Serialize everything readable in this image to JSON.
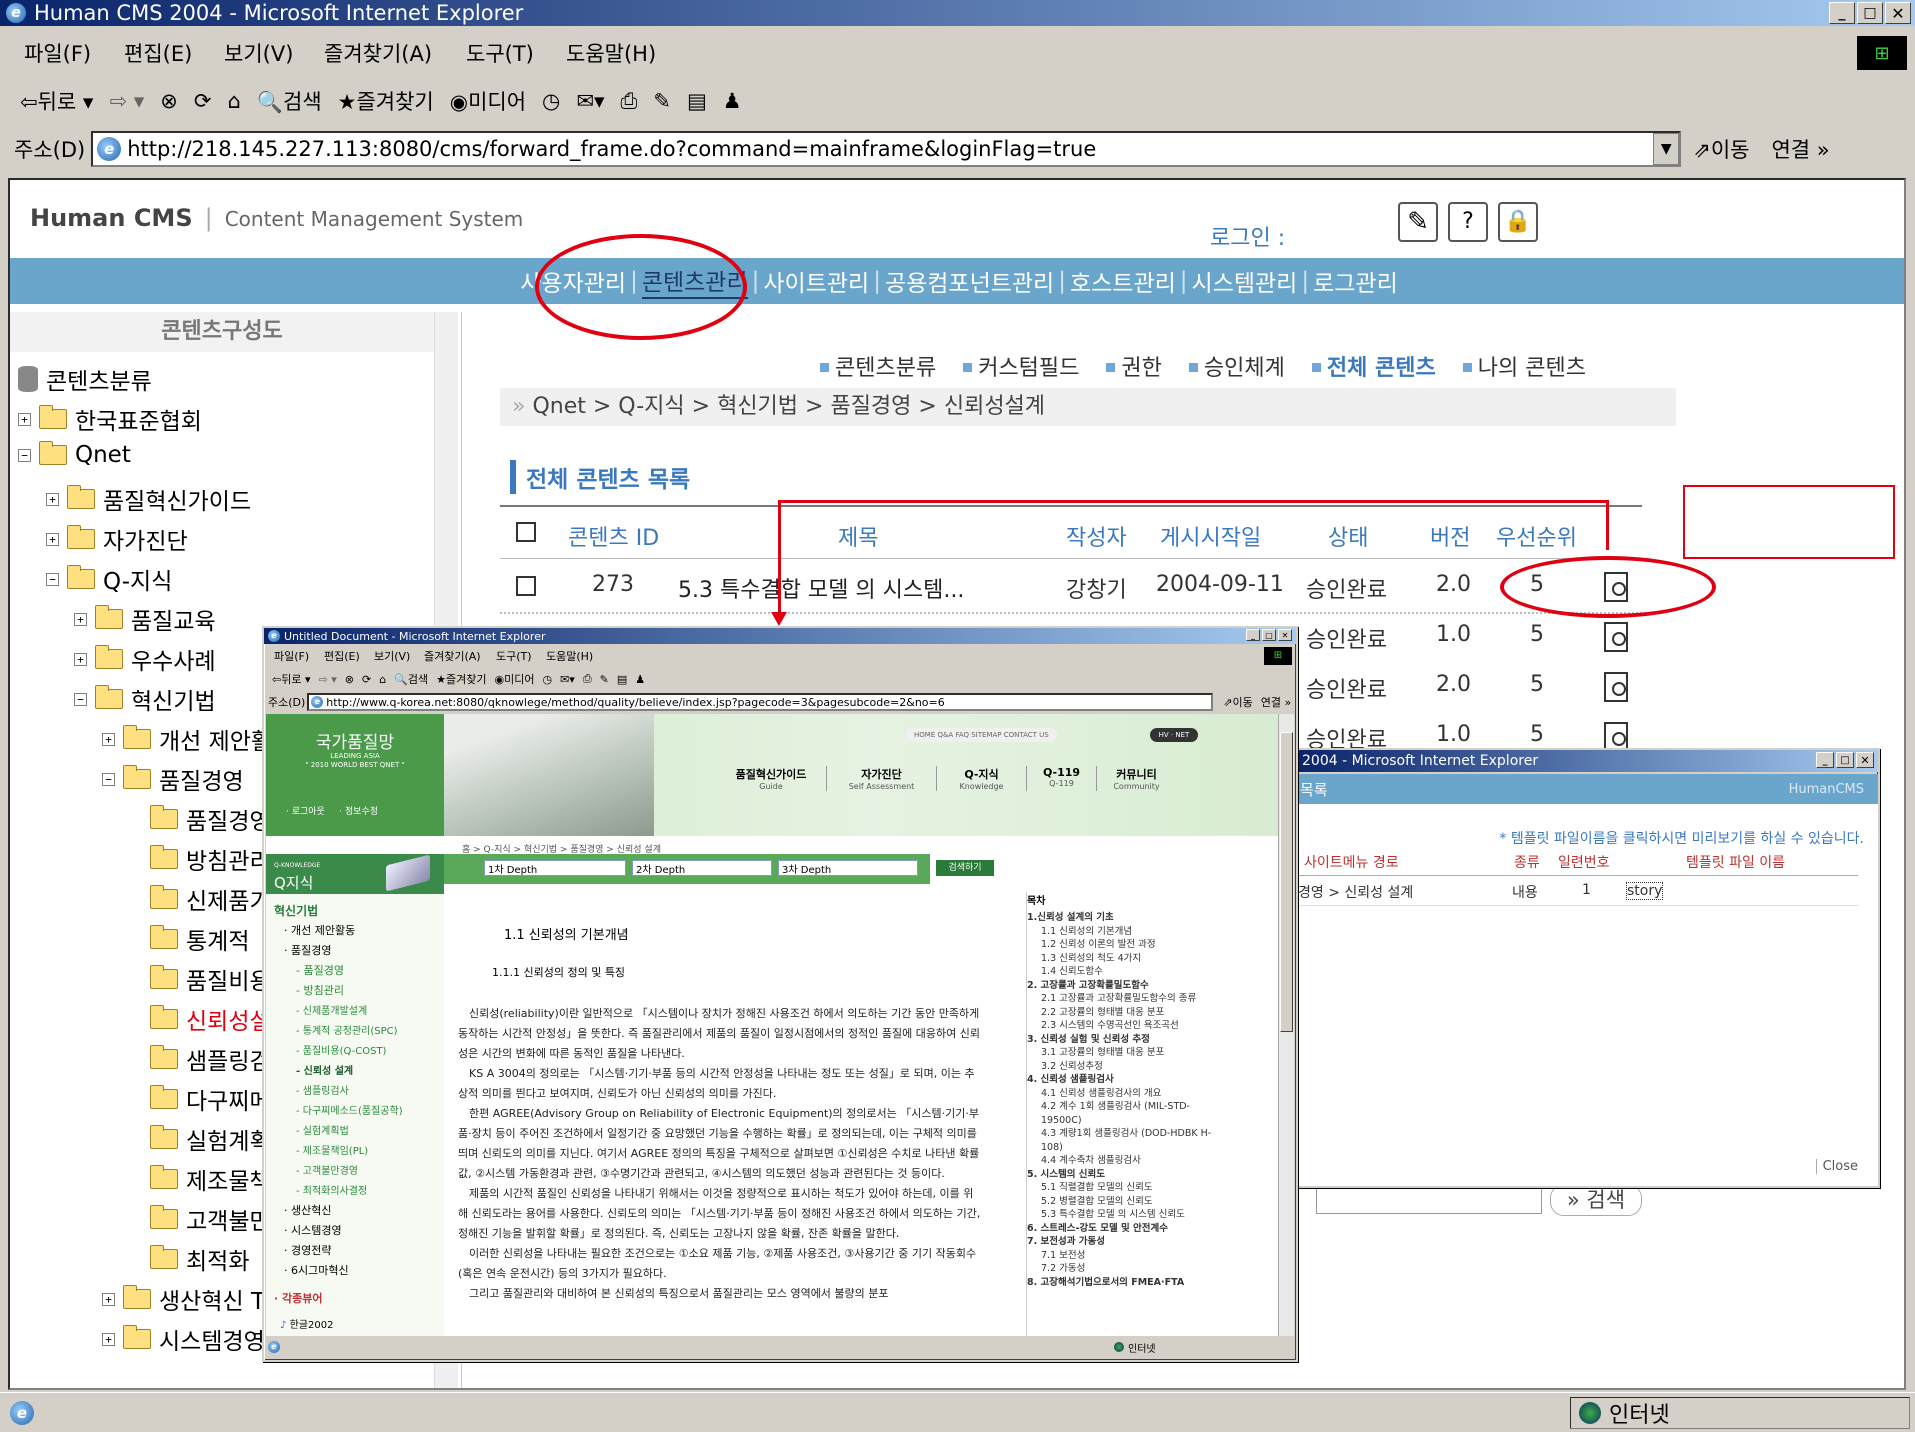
{
  "main_window": {
    "title": "Human CMS 2004 - Microsoft Internet Explorer",
    "menu": [
      "파일(F)",
      "편집(E)",
      "보기(V)",
      "즐겨찾기(A)",
      "도구(T)",
      "도움말(H)"
    ],
    "toolbar": {
      "back": "뒤로",
      "search": "검색",
      "favorites": "즐겨찾기",
      "media": "미디어"
    },
    "address_label": "주소(D)",
    "address": "http://218.145.227.113:8080/cms/forward_frame.do?command=mainframe&loginFlag=true",
    "go": "이동",
    "links": "연결 »",
    "status": "인터넷"
  },
  "cms": {
    "logo": "Human CMS",
    "logo_sub": "Content Management System",
    "login_label": "로그인 :",
    "nav": [
      "사용자관리",
      "콘텐츠관리",
      "사이트관리",
      "공용컴포넌트관리",
      "호스트관리",
      "시스템관리",
      "로그관리"
    ],
    "tree_title": "콘텐츠구성도",
    "tree": [
      {
        "label": "콘텐츠분류"
      },
      {
        "label": "한국표준협회"
      },
      {
        "label": "Qnet"
      },
      {
        "label": "품질혁신가이드"
      },
      {
        "label": "자가진단"
      },
      {
        "label": "Q-지식"
      },
      {
        "label": "품질교육"
      },
      {
        "label": "우수사례"
      },
      {
        "label": "혁신기법"
      },
      {
        "label": "개선 제안활"
      },
      {
        "label": "품질경영"
      },
      {
        "label": "품질경영"
      },
      {
        "label": "방침관리"
      },
      {
        "label": "신제품기"
      },
      {
        "label": "통계적"
      },
      {
        "label": "품질비용"
      },
      {
        "label": "신뢰성설"
      },
      {
        "label": "샘플링검"
      },
      {
        "label": "다구찌메"
      },
      {
        "label": "실험계획"
      },
      {
        "label": "제조물책"
      },
      {
        "label": "고객불만"
      },
      {
        "label": "최적화"
      },
      {
        "label": "생산혁신 T"
      },
      {
        "label": "시스템경영"
      }
    ],
    "subnav": [
      "콘텐츠분류",
      "커스텀필드",
      "권한",
      "승인체계",
      "전체 콘텐츠",
      "나의 콘텐츠"
    ],
    "breadcrumb": "Qnet > Q-지식 > 혁신기법 > 품질경영 > 신뢰성설계",
    "section_title": "전체 콘텐츠 목록",
    "columns": [
      "콘텐츠 ID",
      "제목",
      "작성자",
      "게시시작일",
      "상태",
      "버전",
      "우선순위"
    ],
    "rows": [
      {
        "id": "273",
        "title": "5.3 특수결합 모델 의 시스템...",
        "author": "강창기",
        "date": "2004-09-11",
        "status": "승인완료",
        "version": "2.0",
        "priority": "5"
      },
      {
        "status": "승인완료",
        "version": "1.0",
        "priority": "5"
      },
      {
        "status": "승인완료",
        "version": "2.0",
        "priority": "5"
      },
      {
        "status": "승인완료",
        "version": "1.0",
        "priority": "5"
      }
    ],
    "search_button": "» 검색"
  },
  "popup_window": {
    "title": "Untitled Document - Microsoft Internet Explorer",
    "menu": [
      "파일(F)",
      "편집(E)",
      "보기(V)",
      "즐겨찾기(A)",
      "도구(T)",
      "도움말(H)"
    ],
    "address_label": "주소(D)",
    "address": "http://www.q-korea.net:8080/qknowlege/method/quality/believe/index.jsp?pagecode=3&pagesubcode=2&no=6",
    "go": "이동",
    "links": "연결 »",
    "status": "인터넷",
    "site": {
      "brand": "국가품질망",
      "brand_sub": "LEADING ASIA\n\" 2010 WORLD BEST QNET \"",
      "top_links": "HOME  Q&A  FAQ  SITEMAP  CONTACT US",
      "nav": [
        {
          "ko": "품질혁신가이드",
          "en": "Guide"
        },
        {
          "ko": "자가진단",
          "en": "Self Assessment"
        },
        {
          "ko": "Q-지식",
          "en": "Knowledge"
        },
        {
          "ko": "Q-119",
          "en": "Q-119"
        },
        {
          "ko": "커뮤니티",
          "en": "Community"
        }
      ],
      "login_links": [
        "· 로그아웃",
        "· 정보수정"
      ],
      "section_small": "Q-KNOWLEDGE",
      "section": "Q지식",
      "breadcrumb": "홈 > Q-지식 > 혁신기법 > 품질경영 > 신뢰성 설계",
      "selects": [
        "1차 Depth",
        "2차 Depth",
        "3차 Depth"
      ],
      "search_btn": "검색하기",
      "left_menu": [
        "혁신기법",
        "· 개선 제안활동",
        "· 품질경영",
        "- 품질경영",
        "- 방침관리",
        "- 신제품개발설계",
        "- 통계적 공정관리(SPC)",
        "- 품질비용(Q-COST)",
        "- 신뢰성 설계",
        "- 샘플링검사",
        "- 다구찌메소드(품질공학)",
        "- 실험계획법",
        "- 제조물책임(PL)",
        "- 고객불만경영",
        "- 최적화의사결정",
        "· 생산혁신",
        "· 시스템경영",
        "· 경영전략",
        "· 6시그마혁신"
      ],
      "viewer_label": "· 각종뷰어",
      "viewer_item": "한글2002",
      "heading1": "1.1  신뢰성의 기본개념",
      "heading2": "1.1.1  신뢰성의 정의 및 특징",
      "paragraphs": [
        "신뢰성(reliability)이란 일반적으로 「시스템이나 장치가 정해진 사용조건 하에서 의도하는 기간 동안 만족하게 동작하는 시간적 안정성」을 뜻한다. 즉 품질관리에서 제품의 품질이 일정시점에서의 정적인 품질에 대응하여 신뢰성은 시간의 변화에 따른 동적인 품질을 나타낸다.",
        "KS A 3004의 정의로는 「시스템·기기·부품 등의 시간적 안정성을 나타내는 정도 또는 성질」로 되며, 이는 추상적 의미를 띈다고 보여지며, 신뢰도가 아닌 신뢰성의 의미를 가진다.",
        "한편 AGREE(Advisory Group on Reliability of Electronic Equipment)의 정의로서는 「시스템·기기·부품·장치 등이 주어진 조건하에서 일정기간 중 요망했던 기능을 수행하는 확률」로 정의되는데, 이는 구체적 의미를 띄며 신뢰도의 의미를 지닌다. 여기서 AGREE 정의의 특징을 구체적으로 살펴보면 ①신뢰성은 수치로 나타낸 확률값, ②시스템 가동환경과 관련, ③수명기간과 관련되고, ④시스템의 의도했던 성능과 관련된다는 것 등이다.",
        "제품의 시간적 품질인 신뢰성을 나타내기 위해서는 이것을 정량적으로 표시하는 척도가 있어야 하는데, 이를 위해 신뢰도라는 용어를 사용한다. 신뢰도의 의미는 「시스템·기기·부품 등이 정해진 사용조건 하에서 의도하는 기간, 정해진 기능을 발휘할 확률」로 정의된다. 즉, 신뢰도는 고장나지 않을 확률, 잔존 확률을 말한다.",
        "이러한 신뢰성을 나타내는 필요한 조건으로는 ①소요 제품 기능, ②제품 사용조건, ③사용기간 중 기기 작동회수(혹은 연속 운전시간) 등의 3가지가 필요하다.",
        "그리고 품질관리와 대비하여 본 신뢰성의 특징으로서 품질관리는 모스 영역에서 불량의 분포"
      ],
      "toc_title": "목차",
      "toc": [
        "1.신뢰성 설계의 기초",
        "1.1 신뢰성의 기본개념",
        "1.2 신뢰성 이론의 발전 과정",
        "1.3 신뢰성의 척도 4가지",
        "1.4 신뢰도함수",
        "2. 고장률과 고장확률밀도함수",
        "2.1 고장률과 고장확률밀도함수의 종류",
        "2.2 고장률의 형태별 대응 분포",
        "2.3 시스템의 수명곡선인 욕조곡선",
        "3. 신뢰성 실험 및 신뢰성 추정",
        "3.1 고장률의 형태별 대응 분포",
        "3.2 신뢰성추정",
        "4. 신뢰성 샘플링검사",
        "4.1 신뢰성 샘플링검사의 개요",
        "4.2 계수 1회 샘플링검사 (MIL-STD-19500C)",
        "4.3 계량1회 샘플링검사 (DOD-HDBK H-108)",
        "4.4 계수축차 샘플링검사",
        "5. 시스템의 신뢰도",
        "5.1 직렬결합 모델의 신뢰도",
        "5.2 병렬결합 모델의 신뢰도",
        "5.3 특수결합 모델 의 시스템 신뢰도",
        "6. 스트레스-강도 모델 및 안전계수",
        "7. 보전성과 가동성",
        "7.1 보전성",
        "7.2 가동성",
        "8. 고장해석기법으로서의 FMEA·FTA"
      ]
    }
  },
  "template_window": {
    "title": "2004 - Microsoft Internet Explorer",
    "header_label": "목록",
    "header_brand": "HumanCMS",
    "notice": "* 템플릿 파일이름을 클릭하시면 미리보기를 하실 수 있습니다.",
    "columns": [
      "사이트메뉴 경로",
      "종류",
      "일련번호",
      "템플릿 파일 이름"
    ],
    "row": {
      "path": "경영 > 신뢰성 설계",
      "type": "내용",
      "serial": "1",
      "file": "story"
    },
    "close": "Close"
  },
  "colors": {
    "nav_bar": "#6aa6cc",
    "accent_blue": "#3a78c0",
    "annotation_red": "#e00010",
    "title_bar": "#0a246a"
  }
}
